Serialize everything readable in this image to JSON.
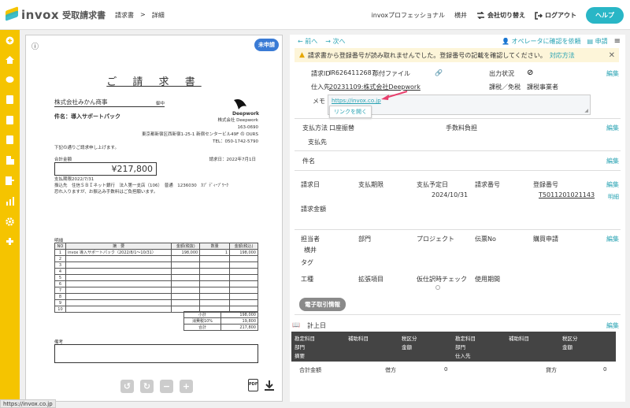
{
  "app": {
    "logo_text": "invox",
    "logo_sub": "受取請求書"
  },
  "breadcrumb": {
    "root": "請求書",
    "sep": ">",
    "current": "詳細"
  },
  "header": {
    "company": "invoxプロフェッショナル",
    "user": "横井",
    "switch_label": "会社切り替え",
    "logout_label": "ログアウト",
    "help_label": "ヘルプ"
  },
  "sidebar": {
    "icons": [
      "plus-circle-icon",
      "home-icon",
      "upload-cloud-icon",
      "document-icon",
      "document-icon",
      "document-icon",
      "building-icon",
      "export-icon",
      "chart-icon",
      "gear-icon",
      "puzzle-icon"
    ]
  },
  "document": {
    "status_badge": "未申請",
    "title": "ご 請 求 書",
    "to_name": "株式会社みかん商事",
    "to_suffix": "御中",
    "subject": "件名：導入サポートパック",
    "issuer_brand": "Deepwork",
    "issuer_lines": [
      "株式会社 Deepwork",
      "163-0690",
      "東京都新宿区西新宿1-25-1 新宿センタービル49F の OURS",
      "TEL：050-1742-5790"
    ],
    "greeting": "下記の通りご請求申し上げます。",
    "total_label": "合計金額",
    "total": "¥217,800",
    "issue_date": "請求日：2022年7月1日",
    "due_label": "支払期限",
    "due_value": "2022/7/31",
    "bank_label": "振込先",
    "bank_value": "住信ＳＢＩネット銀行　法人第一支店（106）　普通　1236030　ｶﾌﾞ ﾃﾞｨｰﾌﾟﾜｰｸ",
    "note": "恐れ入りますが、お振込み手数料はご負担願います。",
    "detail_label": "明細",
    "table_headers": [
      "NO",
      "摘　要",
      "金額(税抜)",
      "数量",
      "金額(税込)"
    ],
    "rows": [
      [
        "1",
        "invox 導入サポートパック（2022/8/1〜10/31）",
        "198,000",
        "1",
        "198,000"
      ],
      [
        "2",
        "",
        "",
        "",
        ""
      ],
      [
        "3",
        "",
        "",
        "",
        ""
      ],
      [
        "4",
        "",
        "",
        "",
        ""
      ],
      [
        "5",
        "",
        "",
        "",
        ""
      ],
      [
        "6",
        "",
        "",
        "",
        ""
      ],
      [
        "7",
        "",
        "",
        "",
        ""
      ],
      [
        "8",
        "",
        "",
        "",
        ""
      ],
      [
        "9",
        "",
        "",
        "",
        ""
      ],
      [
        "10",
        "",
        "",
        "",
        ""
      ]
    ],
    "summary": [
      [
        "小計",
        "198,000"
      ],
      [
        "消費税10%",
        "19,800"
      ],
      [
        "合計",
        "217,800"
      ]
    ],
    "remarks_label": "備考"
  },
  "toolbar": {
    "prev": "前へ",
    "next": "次へ",
    "operator_check": "オペレータに確認を依頼",
    "apply": "申請"
  },
  "warning": {
    "text": "請求書から登録番号が読み取れませんでした。登録番号の記載を確認してください。",
    "link": "対応方法"
  },
  "fields": {
    "request_id_label": "請求ID",
    "request_id": "IR6264112687",
    "attachment_label": "添付ファイル",
    "output_status_label": "出力状況",
    "vendor_label": "仕入先",
    "vendor": "20231109:株式会社Deepwork",
    "tax_label": "課税／免税",
    "tax_value": "課税事業者",
    "memo_label": "メモ",
    "memo_url": "https://invox.co.jp",
    "open_link": "リンクを開く",
    "edit": "編集",
    "payment_method_label": "支払方法",
    "payment_method": "口座振替",
    "fee_label": "手数料負担",
    "payee_label": "支払先",
    "subject_label": "件名",
    "bill_date_label": "請求日",
    "due_label": "支払期限",
    "planned_label": "支払予定日",
    "planned_value": "2024/10/31",
    "bill_no_label": "請求番号",
    "reg_no_label": "登録番号",
    "reg_no": "T5011201021143",
    "detail_link": "明細",
    "amount_label": "請求金額",
    "person_label": "担当者",
    "person": "横井",
    "dept_label": "部門",
    "project_label": "プロジェクト",
    "voucher_label": "伝票No",
    "purchase_label": "購買申請",
    "tag_label": "タグ",
    "work_label": "工種",
    "ext_label": "拡張項目",
    "provisional_label": "仮仕訳時チェック",
    "period_label": "使用期間",
    "e_trade_btn": "電子取引情報",
    "recorded_label": "計上日"
  },
  "accounting": {
    "left_headers": [
      "勘定科目",
      "補助科目",
      "税区分",
      "部門",
      "金額",
      "摘要"
    ],
    "right_headers": [
      "勘定科目",
      "補助科目",
      "税区分",
      "部門",
      "金額",
      "仕入先"
    ],
    "total_label": "合計金額",
    "debit_label": "借方",
    "debit_value": "0",
    "credit_label": "貸方",
    "credit_value": "0"
  },
  "status_url": "https://invox.co.jp"
}
